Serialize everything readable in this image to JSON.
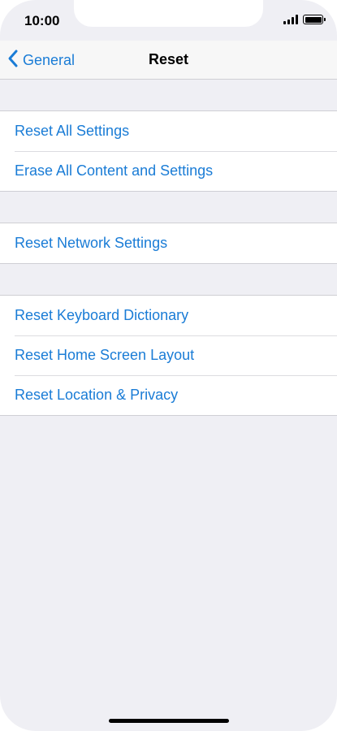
{
  "status_bar": {
    "time": "10:00"
  },
  "nav": {
    "back_label": "General",
    "title": "Reset"
  },
  "groups": [
    {
      "items": [
        {
          "label": "Reset All Settings"
        },
        {
          "label": "Erase All Content and Settings"
        }
      ]
    },
    {
      "items": [
        {
          "label": "Reset Network Settings"
        }
      ]
    },
    {
      "items": [
        {
          "label": "Reset Keyboard Dictionary"
        },
        {
          "label": "Reset Home Screen Layout"
        },
        {
          "label": "Reset Location & Privacy"
        }
      ]
    }
  ],
  "colors": {
    "accent": "#1a7cd6",
    "background": "#efeff4",
    "cell": "#ffffff"
  },
  "icons": {
    "back": "chevron-left-icon",
    "signal": "cellular-signal-icon",
    "battery": "battery-icon"
  }
}
